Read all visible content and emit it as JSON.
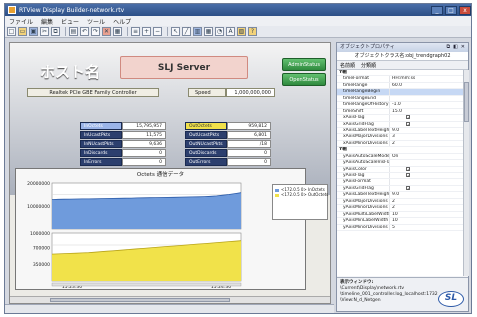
{
  "window": {
    "title": "RTView Display Builder-network.rtv",
    "controls": {
      "minimize": "_",
      "maximize": "□",
      "close": "x"
    }
  },
  "menu": [
    "ファイル",
    "編集",
    "ビュー",
    "ツール",
    "ヘルプ"
  ],
  "toolbar_icons": [
    "new-icon",
    "open-icon",
    "save-icon",
    "cut-icon",
    "copy-icon",
    "paste-icon",
    "undo-icon",
    "redo-icon",
    "delete-icon",
    "grid-icon",
    "align-icon",
    "zoom-in-icon",
    "zoom-out-icon",
    "arrow-icon",
    "line-icon",
    "chart-icon",
    "table-icon",
    "gauge-icon",
    "label-icon",
    "image-icon",
    "help-icon"
  ],
  "display": {
    "page_title": "ホスト名",
    "server_name": "SLJ Server",
    "buttons": {
      "admin": "AdminStatus",
      "open": "OpenStatus"
    },
    "controller": "Realtek PCIe GBE Family Controller",
    "speed_label": "Speed",
    "speed_value": "1,000,000,000",
    "metrics_left": [
      {
        "label": "InOctets",
        "value": "15,795,957",
        "style": "hl-blue"
      },
      {
        "label": "InUcastPkts",
        "value": "11,575",
        "style": ""
      },
      {
        "label": "InNUcastPkts",
        "value": "9,636",
        "style": ""
      },
      {
        "label": "InDiscards",
        "value": "0",
        "style": ""
      },
      {
        "label": "InErrors",
        "value": "0",
        "style": ""
      }
    ],
    "metrics_right": [
      {
        "label": "OutOctets",
        "value": "959,812",
        "style": "hl-yellow"
      },
      {
        "label": "OutUcastPkts",
        "value": "6,801",
        "style": ""
      },
      {
        "label": "OutNUcastPkts",
        "value": "/18",
        "style": ""
      },
      {
        "label": "OutDiscards",
        "value": "0",
        "style": ""
      },
      {
        "label": "OutErrors",
        "value": "0",
        "style": ""
      }
    ]
  },
  "chart_data": {
    "type": "area",
    "title": "Octets 通信データ",
    "panels": [
      {
        "name": "InOctets",
        "ylim": [
          0,
          20000000
        ],
        "yticks": [
          "20000000",
          "10000000"
        ],
        "color": "#6f9bdc",
        "values": [
          12800000,
          12900000,
          12950000,
          13000000,
          13050000,
          13100000,
          13100000,
          13150000,
          13200000,
          13250000,
          13300000,
          13350000,
          13400000,
          13450000,
          13500000,
          13550000,
          13600000,
          13650000,
          13700000,
          13750000,
          13800000,
          13850000,
          13900000,
          13950000,
          14000000,
          14100000,
          14200000,
          14400000,
          14700000,
          15000000,
          15400000,
          15795957
        ]
      },
      {
        "name": "OutOctets",
        "ylim": [
          0,
          1000000
        ],
        "yticks": [
          "1000000",
          "700000",
          "350000"
        ],
        "color": "#f1e24a",
        "values": [
          560000,
          565000,
          570000,
          575000,
          580000,
          585000,
          590000,
          600000,
          610000,
          620000,
          630000,
          640000,
          650000,
          660000,
          670000,
          680000,
          690000,
          700000,
          710000,
          720000,
          730000,
          740000,
          750000,
          760000,
          770000,
          780000,
          790000,
          800000,
          810000,
          820000,
          830000,
          840000
        ]
      }
    ],
    "x_ticks": [
      "15:23:30",
      "15:24:30"
    ],
    "legend": [
      {
        "name": "<172.0.5 0> InOctets",
        "color": "#6f9bdc"
      },
      {
        "name": "<172.0.5 0> OutOctets",
        "color": "#f1e24a"
      }
    ]
  },
  "properties": {
    "header": "オブジェクトプロパティ",
    "class_label": "オブジェクトクラス名:obj_trendgraph02",
    "tools": [
      "名前順",
      "分類順"
    ],
    "rows": [
      {
        "type": "cat",
        "name": "Y軸"
      },
      {
        "type": "row",
        "name": "timeFormat",
        "value": "HH:mm:ss"
      },
      {
        "type": "row",
        "name": "timeRange",
        "value": "60.0"
      },
      {
        "type": "row",
        "name": "timeRangeBegin",
        "value": "",
        "selected": true
      },
      {
        "type": "row",
        "name": "timeRangeEnd",
        "value": ""
      },
      {
        "type": "row",
        "name": "timeRangeOfHistory",
        "value": "-1.0"
      },
      {
        "type": "row",
        "name": "timeShift",
        "value": "15.0"
      },
      {
        "type": "row",
        "name": "xAxisFlag",
        "value": "",
        "check": true
      },
      {
        "type": "row",
        "name": "xAxisGridFlag",
        "value": "",
        "check": true
      },
      {
        "type": "row",
        "name": "xAxisLabelTextHeight",
        "value": "9.0"
      },
      {
        "type": "row",
        "name": "xAxisMajorDivisions",
        "value": "3"
      },
      {
        "type": "row",
        "name": "xAxisMinorDivisions",
        "value": "2"
      },
      {
        "type": "cat",
        "name": "Y軸"
      },
      {
        "type": "row",
        "name": "yAxisAutoScaleMode",
        "value": "On"
      },
      {
        "type": "row",
        "name": "yAxisAutoScaleVisFlag",
        "value": ""
      },
      {
        "type": "row",
        "name": "yAxisColor",
        "value": "",
        "check": true
      },
      {
        "type": "row",
        "name": "yAxisFlag",
        "value": "",
        "check": true
      },
      {
        "type": "row",
        "name": "yAxisFormat",
        "value": ""
      },
      {
        "type": "row",
        "name": "yAxisGridFlag",
        "value": "",
        "check": true
      },
      {
        "type": "row",
        "name": "yAxisLabelTextHeight",
        "value": "9.0"
      },
      {
        "type": "row",
        "name": "yAxisMajorDivisions",
        "value": "2"
      },
      {
        "type": "row",
        "name": "yAxisMinorDivisions",
        "value": "2"
      },
      {
        "type": "row",
        "name": "yAxisMultiLabelWidth",
        "value": "10"
      },
      {
        "type": "row",
        "name": "yAxisMinLabelWidth",
        "value": "10"
      },
      {
        "type": "row",
        "name": "yAxisMinorDivisions",
        "value": "5"
      }
    ],
    "desc_title": "表示ウィンドウ:",
    "desc_lines": [
      "\\Current\\Display\\network.rtv",
      "\\timeline_001_controller.log_localhost:1732",
      "\\View:N_d_Netgen"
    ]
  },
  "logo_text": "SL"
}
